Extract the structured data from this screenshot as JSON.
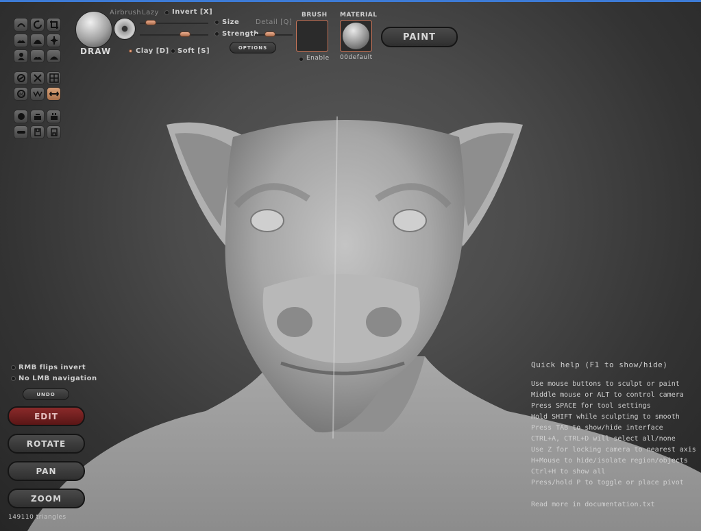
{
  "toolbar": {
    "tool_icons": [
      "draw-tool-icon",
      "rotate-tool-icon",
      "crop-tool-icon",
      "flatten-tool-icon",
      "inflate-tool-icon",
      "move-tool-icon",
      "smooth-tool-icon",
      "clay-tool-icon",
      "pinch-tool-icon"
    ],
    "symmetry_icons": [
      "symmetry-icon",
      "mirror-x-icon",
      "grid-icon",
      "mask-icon",
      "wave-icon",
      "swap-icon"
    ],
    "extra_icons": [
      "sphere-icon",
      "scale-icon",
      "scale-alt-icon",
      "layer-icon",
      "save-icon",
      "load-icon"
    ]
  },
  "brush": {
    "tool_label": "DRAW",
    "airbrush_label": "Airbrush",
    "lazy_label": "Lazy",
    "invert_label": "Invert [X]",
    "size_label": "Size",
    "detail_label": "Detail [Q]",
    "strength_label": "Strength",
    "clay_label": "Clay [D]",
    "soft_label": "Soft [S]",
    "options_label": "OPTIONS"
  },
  "brush_panel": {
    "title": "BRUSH",
    "enable_label": "Enable"
  },
  "material_panel": {
    "title": "MATERIAL",
    "name": "00default"
  },
  "paint_label": "PAINT",
  "left_panel": {
    "rmb_flips_invert": "RMB flips invert",
    "no_lmb_navigation": "No LMB navigation",
    "undo_label": "UNDO",
    "edit_label": "EDIT",
    "rotate_label": "ROTATE",
    "pan_label": "PAN",
    "zoom_label": "ZOOM",
    "triangles": "149110 triangles"
  },
  "quick_help": {
    "title": "Quick help (F1 to show/hide)",
    "lines": [
      "Use mouse buttons to sculpt or paint",
      "Middle mouse or ALT to control camera",
      "Press SPACE for tool settings",
      "Hold SHIFT while sculpting to smooth",
      "Press TAB to show/hide interface",
      "CTRL+A, CTRL+D will select all/none",
      "Use Z for locking camera to nearest axis",
      "H+Mouse to hide/isolate region/objects",
      "Ctrl+H to show all",
      "Press/hold P to toggle or place pivot"
    ],
    "footer": "Read more in documentation.txt"
  },
  "colors": {
    "edit_active": "#7a2222",
    "accent_knob": "#d89a78",
    "swatch_border": "#c8765a",
    "top_accent": "#3d7bd6"
  }
}
